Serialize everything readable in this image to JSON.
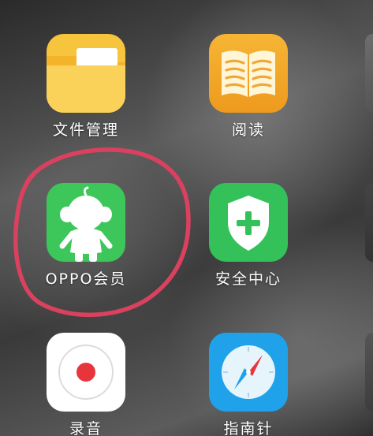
{
  "home_screen": {
    "apps": [
      {
        "id": "files",
        "label": "文件管理",
        "icon": "folder-icon"
      },
      {
        "id": "reader",
        "label": "阅读",
        "icon": "open-book-icon"
      },
      {
        "id": "oppo-member",
        "label": "OPPO会员",
        "icon": "mascot-icon"
      },
      {
        "id": "security",
        "label": "安全中心",
        "icon": "shield-plus-icon"
      },
      {
        "id": "recorder",
        "label": "录音",
        "icon": "record-icon"
      },
      {
        "id": "compass",
        "label": "指南针",
        "icon": "compass-icon"
      }
    ],
    "highlight": {
      "target": "oppo-member",
      "color": "#d9415f"
    }
  },
  "colors": {
    "files": "#f7c43e",
    "reader": "#f2a728",
    "oppo_member": "#3dc65a",
    "security": "#34c15a",
    "recorder": "#ffffff",
    "compass": "#1fa2ea"
  }
}
